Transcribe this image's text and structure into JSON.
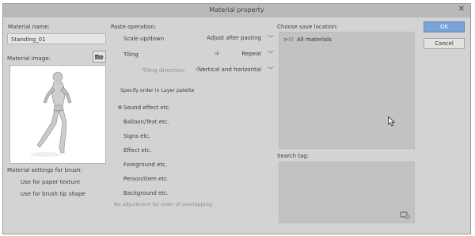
{
  "window": {
    "title": "Material property",
    "close_glyph": "✕"
  },
  "left": {
    "material_name_label": "Material name:",
    "material_name_value": "Standing_01",
    "material_image_label": "Material image:",
    "brush_settings_label": "Material settings for brush:",
    "use_paper_texture": "Use for paper texture",
    "use_brush_tip": "Use for brush tip shape"
  },
  "paste": {
    "label": "Paste operation:",
    "scale_label": "Scale up/down",
    "scale_value": "Adjust after pasting",
    "tiling_label": "Tiling",
    "tiling_value": "Repeat",
    "tiling_direction_label": "Tiling direction:",
    "tiling_direction_value": "Vertical and horizontal",
    "layer_order_label": "Specify order in Layer palette",
    "order_options": [
      "Sound effect etc.",
      "Balloon/Text etc.",
      "Signs etc.",
      "Effect etc.",
      "Foreground etc.",
      "Person/Item etc.",
      "Background etc."
    ],
    "no_adjust": "No adjustment for order of overlapping."
  },
  "save": {
    "label": "Choose save location:",
    "tree_item": "All materials",
    "search_tag_label": "Search tag:"
  },
  "buttons": {
    "ok": "OK",
    "cancel": "Cancel"
  },
  "colors": {
    "ok_blue": "#7aa4d6",
    "dialog_bg": "#d3d3d3",
    "panel_bg": "#c2c2c2"
  },
  "icons": [
    "folder-open-icon",
    "close-icon",
    "chevron-down-icon",
    "tree-expand-icon",
    "add-tag-icon",
    "mouse-cursor-icon"
  ]
}
